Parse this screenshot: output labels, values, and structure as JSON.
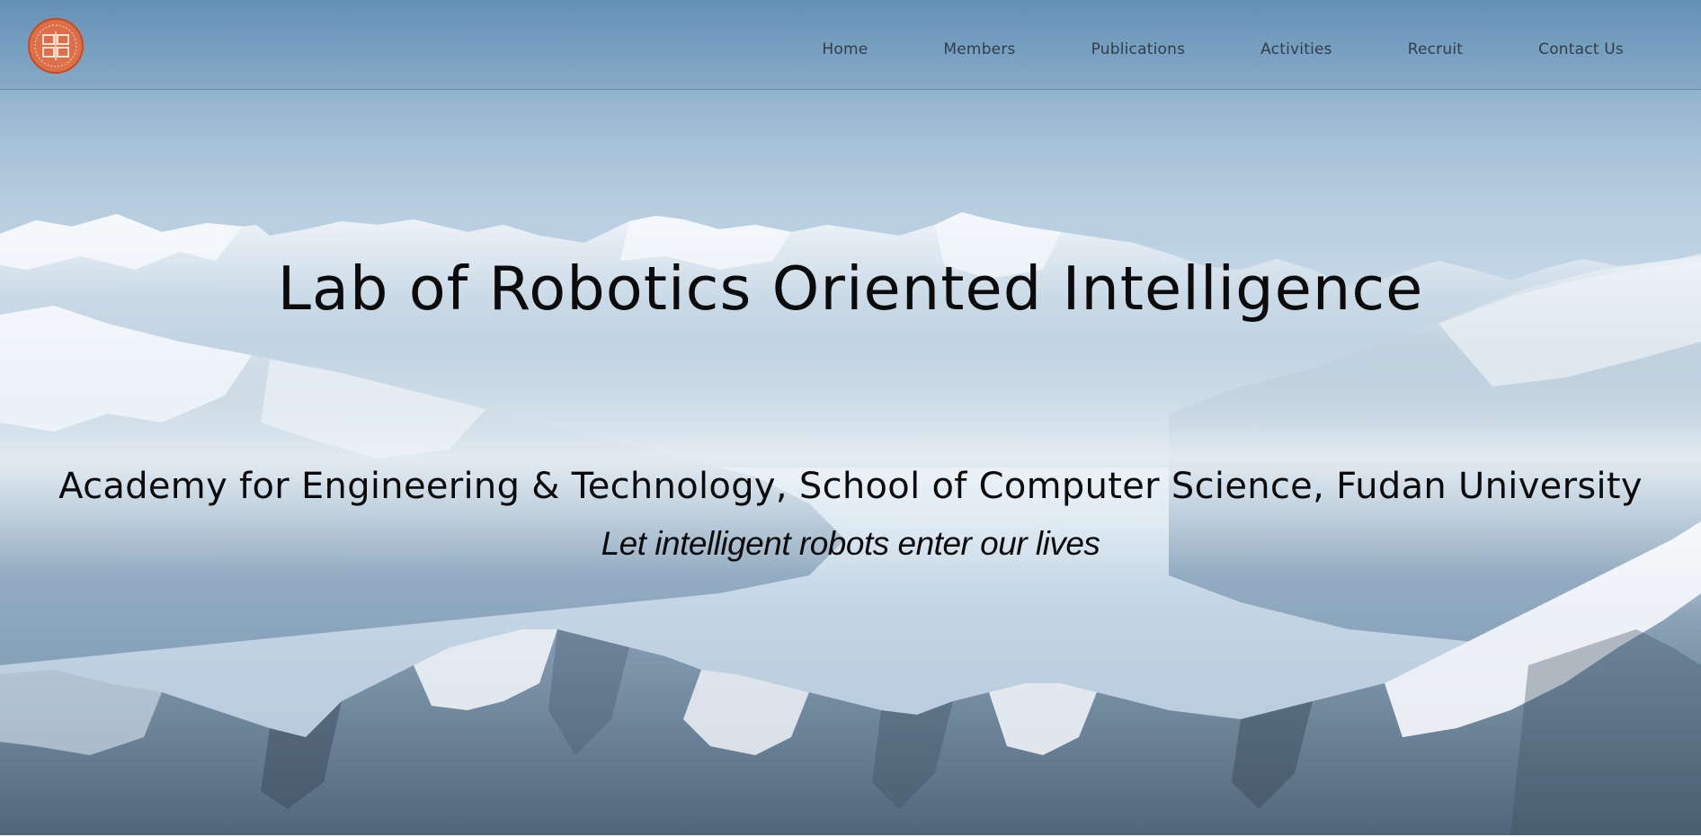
{
  "site": {
    "logo_name": "fudan-university-seal"
  },
  "nav": {
    "items": [
      {
        "label": "Home"
      },
      {
        "label": "Members"
      },
      {
        "label": "Publications"
      },
      {
        "label": "Activities"
      },
      {
        "label": "Recruit"
      },
      {
        "label": "Contact Us"
      }
    ]
  },
  "hero": {
    "title": "Lab of Robotics Oriented Intelligence",
    "subtitle": "Academy for Engineering & Technology, School of Computer Science, Fudan University",
    "slogan": "Let intelligent robots enter our lives",
    "background": "snowy-mountain-range"
  },
  "colors": {
    "logo": "#d9552a",
    "nav_text": "#2f3e4c",
    "title_text": "#0b0b0b",
    "sky_top": "#6f9cbf"
  }
}
